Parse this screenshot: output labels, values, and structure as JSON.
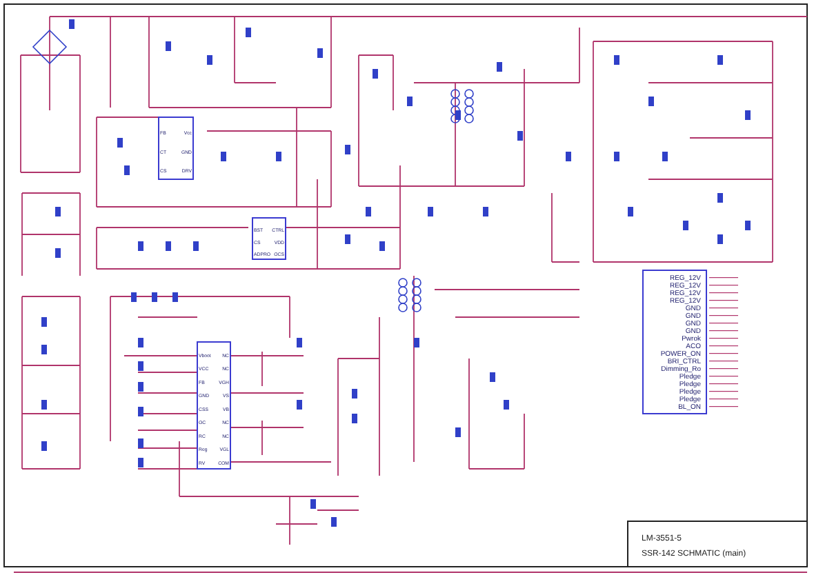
{
  "ic_blocks": [
    {
      "pins_left": [
        "FB",
        "CT",
        "CS"
      ],
      "pins_right": [
        "Vcc",
        "GND",
        "DRV"
      ]
    },
    {
      "pins_left": [
        "BST",
        "CS",
        "ADPRO"
      ],
      "pins_right": [
        "CTRL",
        "VDD",
        "OCS"
      ]
    },
    {
      "pins_left": [
        "Vboot",
        "VCC",
        "FB",
        "GND",
        "CSS",
        "OC",
        "RC",
        "Reg",
        "RV"
      ],
      "pins_right": [
        "NC",
        "NC",
        "VGH",
        "VS",
        "VB",
        "NC",
        "NC",
        "VGL",
        "COM"
      ]
    }
  ],
  "connector": {
    "labels": [
      "REG_12V",
      "REG_12V",
      "REG_12V",
      "REG_12V",
      "GND",
      "GND",
      "GND",
      "GND",
      "Pwrok",
      "ACO",
      "POWER_ON",
      "BRI_CTRL",
      "Dimming_Ro",
      "Pledge",
      "Pledge",
      "Pledge",
      "Pledge",
      "BL_ON"
    ]
  },
  "title_block": {
    "rows": [
      "LM-3551-5",
      "SSR-142 SCHMATIC (main)"
    ]
  }
}
